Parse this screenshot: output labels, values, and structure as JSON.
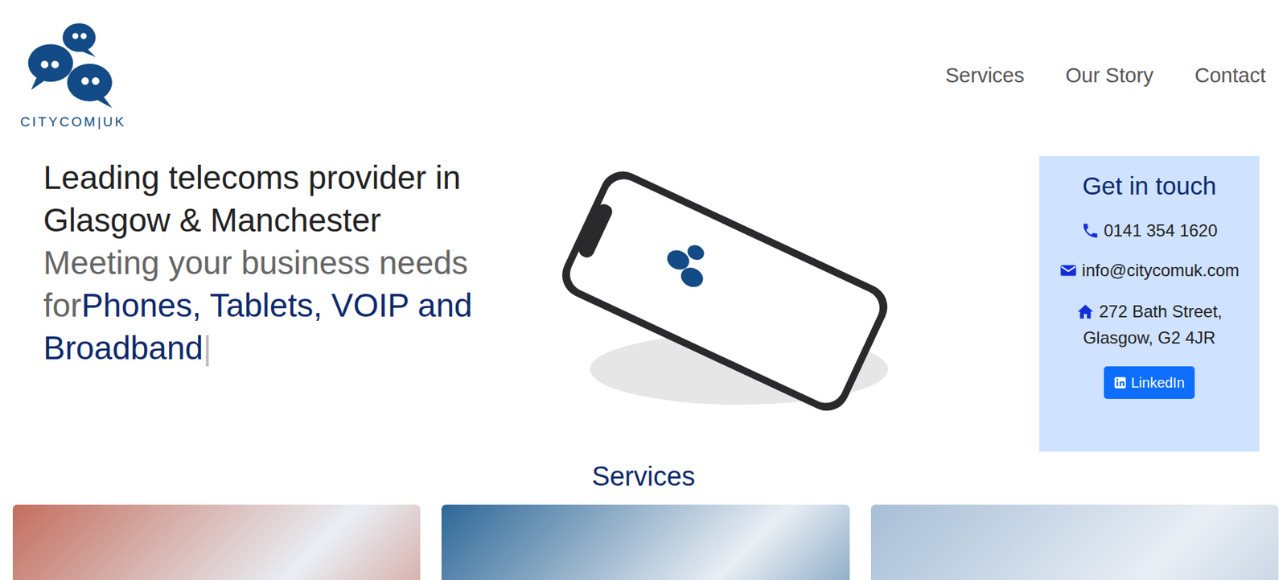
{
  "logo": {
    "text": "CITYCOM|UK"
  },
  "nav": [
    {
      "label": "Services"
    },
    {
      "label": "Our Story"
    },
    {
      "label": "Contact"
    }
  ],
  "hero": {
    "headline": "Leading telecoms provider in Glasgow & Manchester",
    "lead": "Meeting your business needs for",
    "highlight": "Phones, Tablets, VOIP and Broadband",
    "cursor": "|"
  },
  "contact": {
    "title": "Get in touch",
    "phone": "0141 354 1620",
    "email": "info@citycomuk.com",
    "address": [
      "272 Bath Street,",
      "Glasgow, G2 4JR"
    ],
    "button": "LinkedIn"
  },
  "services": {
    "title": "Services",
    "cards": [
      {
        "color": "#c46e5e"
      },
      {
        "color": "#2d6797"
      },
      {
        "color": "#a7bed6"
      }
    ]
  }
}
